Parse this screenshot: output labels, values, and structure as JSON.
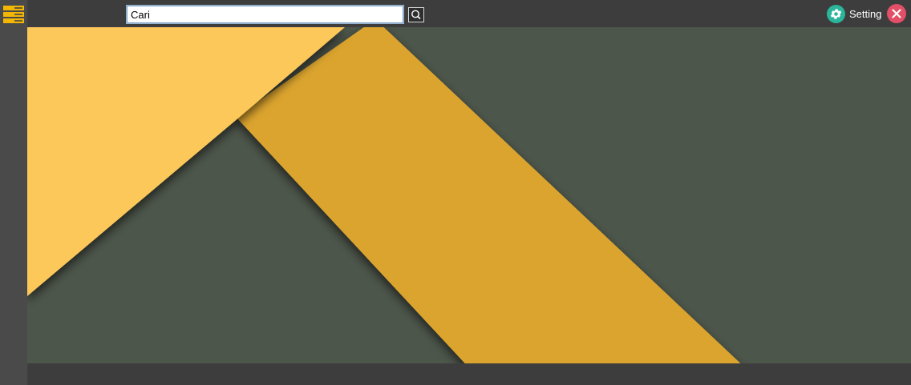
{
  "menu": {
    "icon": "hamburger-menu-icon",
    "color": "#f2b705"
  },
  "search": {
    "value": "Cari",
    "icon": "search-icon"
  },
  "settings": {
    "label": "Setting",
    "icon": "gear-icon",
    "color": "#2bb59b"
  },
  "close": {
    "icon": "close-icon",
    "color": "#e24f66"
  },
  "wallpaper": {
    "colors": {
      "background": "#4d564b",
      "light_yellow": "#fdc85a",
      "dark_yellow": "#dba42e"
    }
  }
}
